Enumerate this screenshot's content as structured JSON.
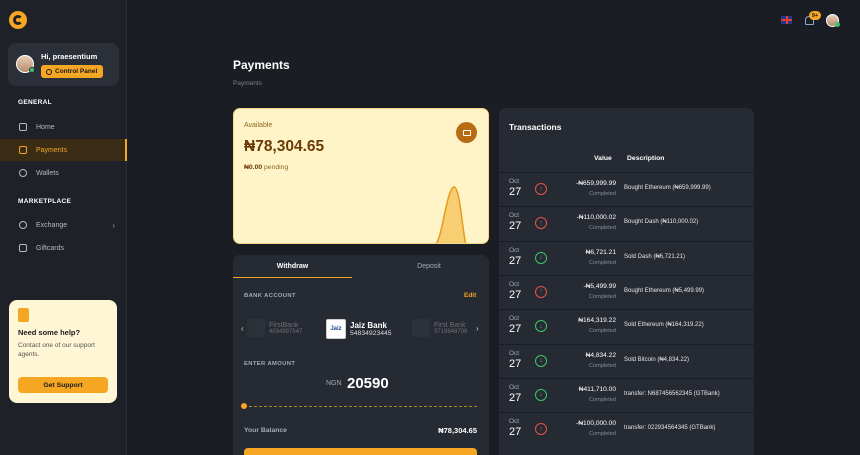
{
  "sidebar": {
    "greeting": "Hi, praesentium",
    "control_panel": "Control Panel",
    "general_label": "GENERAL",
    "marketplace_label": "MARKETPLACE",
    "items": [
      {
        "label": "Home",
        "icon": "home-icon"
      },
      {
        "label": "Payments",
        "icon": "payments-icon",
        "active": true
      },
      {
        "label": "Wallets",
        "icon": "wallet-icon"
      },
      {
        "label": "Exchange",
        "icon": "exchange-icon"
      },
      {
        "label": "Giftcards",
        "icon": "giftcard-icon"
      }
    ],
    "help": {
      "title": "Need some help?",
      "text": "Contact one of our support agents.",
      "button": "Get Support"
    }
  },
  "topbar": {
    "notification_count": "9+",
    "flag": "uk-flag-icon"
  },
  "page": {
    "title": "Payments",
    "breadcrumb": "Payments"
  },
  "available": {
    "label": "Available",
    "amount": "₦78,304.65",
    "pending_amount": "₦0.00",
    "pending_label": "pending"
  },
  "withdraw": {
    "tabs": [
      "Withdraw",
      "Deposit"
    ],
    "bank_label": "BANK ACCOUNT",
    "edit": "Edit",
    "banks": [
      {
        "name": "FirstBank",
        "account": "4034897547"
      },
      {
        "name": "Jaiz Bank",
        "account": "54834923445",
        "logo": "Jaiz"
      },
      {
        "name": "First Bank",
        "account": "3719648709"
      }
    ],
    "amount_label": "ENTER AMOUNT",
    "currency": "NGN",
    "amount": "20590",
    "balance_label": "Your Balance",
    "balance": "₦78,304.65"
  },
  "transactions": {
    "title": "Transactions",
    "headers": {
      "value": "Value",
      "description": "Description"
    },
    "rows": [
      {
        "month": "Oct",
        "day": "27",
        "direction": "up",
        "value": "-₦659,999.99",
        "status": "Completed",
        "description": "Bought Ethereum (₦659,999.99)"
      },
      {
        "month": "Oct",
        "day": "27",
        "direction": "up",
        "value": "-₦110,000.02",
        "status": "Completed",
        "description": "Bought Dash (₦110,000.02)"
      },
      {
        "month": "Oct",
        "day": "27",
        "direction": "down",
        "value": "₦6,721.21",
        "status": "Completed",
        "description": "Sold Dash (₦6,721.21)"
      },
      {
        "month": "Oct",
        "day": "27",
        "direction": "up",
        "value": "-₦5,499.99",
        "status": "Completed",
        "description": "Bought Ethereum (₦5,499.99)"
      },
      {
        "month": "Oct",
        "day": "27",
        "direction": "down",
        "value": "₦164,319.22",
        "status": "Completed",
        "description": "Sold Ethereum (₦164,319.22)"
      },
      {
        "month": "Oct",
        "day": "27",
        "direction": "down",
        "value": "₦4,834.22",
        "status": "Completed",
        "description": "Sold Bitcoin (₦4,834.22)"
      },
      {
        "month": "Oct",
        "day": "27",
        "direction": "down",
        "value": "₦411,710.00",
        "status": "Completed",
        "description": "transfer: N687456562345 (GTBank)"
      },
      {
        "month": "Oct",
        "day": "27",
        "direction": "up",
        "value": "-₦100,000.00",
        "status": "Completed",
        "description": "transfer: 022934564345 (GTBank)"
      }
    ]
  }
}
